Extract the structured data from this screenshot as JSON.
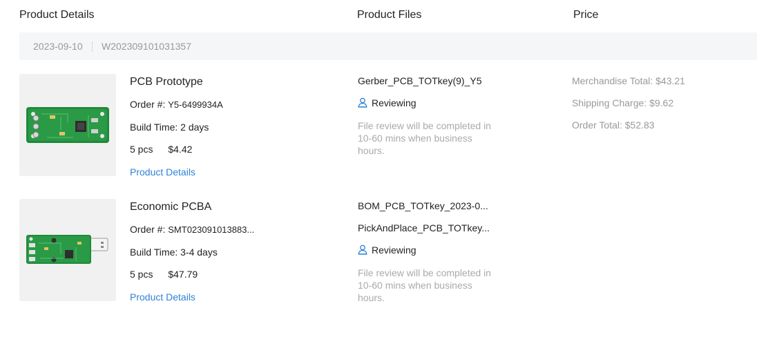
{
  "header": {
    "details": "Product Details",
    "files": "Product Files",
    "price": "Price"
  },
  "order": {
    "date": "2023-09-10",
    "number": "W202309101031357"
  },
  "items": [
    {
      "name": "PCB Prototype",
      "order_label": "Order #:",
      "order_no": "Y5-6499934A",
      "build_label": "Build Time:",
      "build_time": "2 days",
      "qty": "5 pcs",
      "price": "$4.42",
      "link": "Product Details",
      "files": [
        "Gerber_PCB_TOTkey(9)_Y5"
      ],
      "status": "Reviewing",
      "status_icon": "reviewer-icon",
      "note": "File review will be completed in 10-60 mins when business hours."
    },
    {
      "name": "Economic PCBA",
      "order_label": "Order #:",
      "order_no": "SMT023091013883...",
      "build_label": "Build Time:",
      "build_time": "3-4 days",
      "qty": "5 pcs",
      "price": "$47.79",
      "link": "Product Details",
      "files": [
        "BOM_PCB_TOTkey_2023-0...",
        "PickAndPlace_PCB_TOTkey..."
      ],
      "status": "Reviewing",
      "status_icon": "reviewer-icon",
      "note": "File review will be completed in 10-60 mins when business hours."
    }
  ],
  "pricing": {
    "merchandise": "Merchandise Total: $43.21",
    "shipping": "Shipping Charge: $9.62",
    "total": "Order Total: $52.83"
  },
  "colors": {
    "link": "#2d82d8",
    "pcb_green": "#1f8a3a",
    "muted": "#999999"
  }
}
